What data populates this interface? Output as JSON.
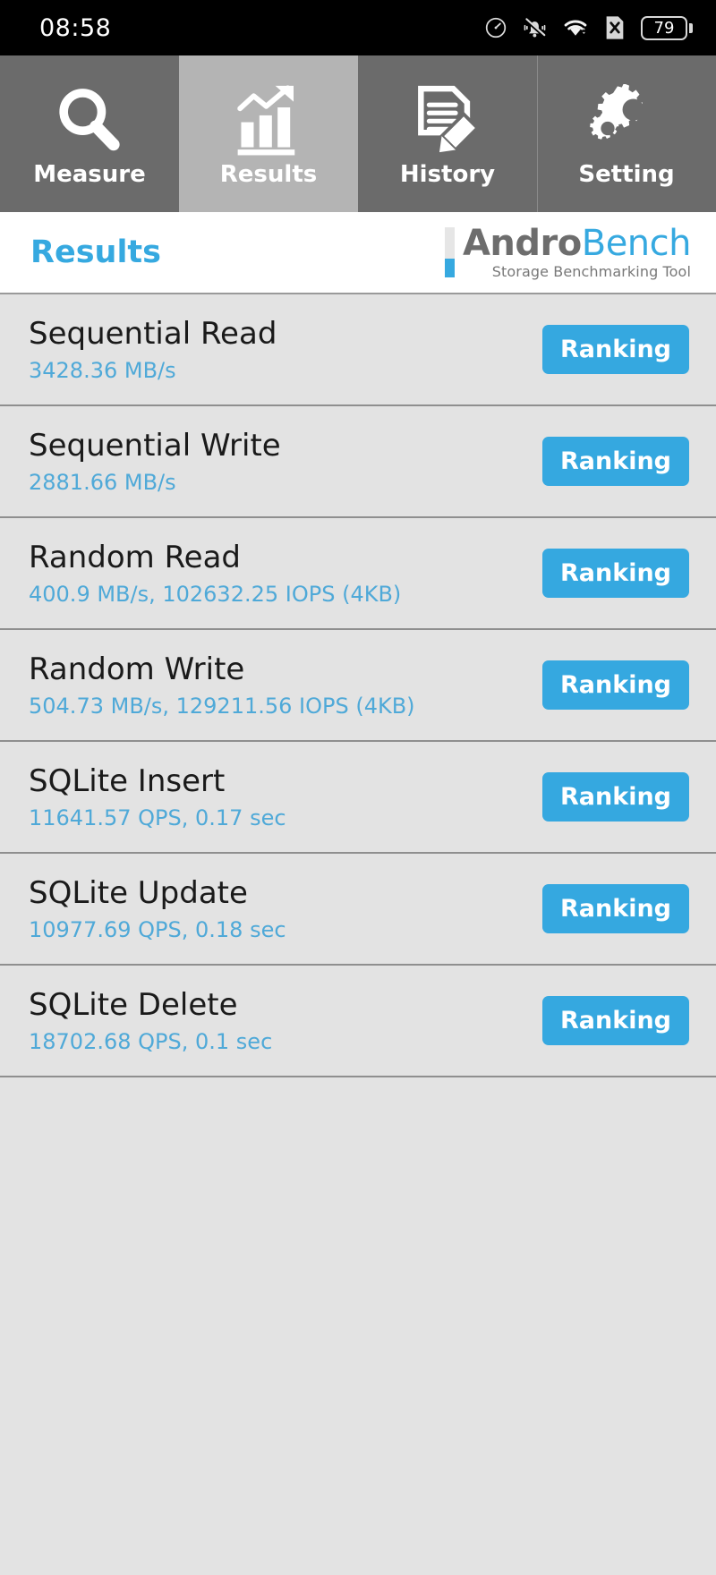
{
  "statusbar": {
    "time": "08:58",
    "battery_level": "79",
    "icons": [
      "speedometer-icon",
      "bell-muted-icon",
      "wifi-icon",
      "sim-x-icon",
      "battery-icon"
    ]
  },
  "tabs": [
    {
      "label": "Measure",
      "icon": "magnifier-icon",
      "active": false
    },
    {
      "label": "Results",
      "icon": "bar-chart-arrow-icon",
      "active": true
    },
    {
      "label": "History",
      "icon": "document-pencil-icon",
      "active": false
    },
    {
      "label": "Setting",
      "icon": "gears-icon",
      "active": false
    }
  ],
  "header": {
    "title": "Results",
    "logo_primary": "Andro",
    "logo_secondary": "Bench",
    "logo_tagline": "Storage Benchmarking Tool"
  },
  "colors": {
    "accent": "#36a9e0",
    "value_text": "#4fa9d8",
    "tab_inactive": "#6b6b6b",
    "tab_active": "#b4b4b4",
    "list_background": "#e3e3e3"
  },
  "results": [
    {
      "title": "Sequential Read",
      "value": "3428.36 MB/s",
      "button": "Ranking"
    },
    {
      "title": "Sequential Write",
      "value": "2881.66 MB/s",
      "button": "Ranking"
    },
    {
      "title": "Random Read",
      "value": "400.9 MB/s, 102632.25 IOPS (4KB)",
      "button": "Ranking"
    },
    {
      "title": "Random Write",
      "value": "504.73 MB/s, 129211.56 IOPS (4KB)",
      "button": "Ranking"
    },
    {
      "title": "SQLite Insert",
      "value": "11641.57 QPS, 0.17 sec",
      "button": "Ranking"
    },
    {
      "title": "SQLite Update",
      "value": "10977.69 QPS, 0.18 sec",
      "button": "Ranking"
    },
    {
      "title": "SQLite Delete",
      "value": "18702.68 QPS, 0.1 sec",
      "button": "Ranking"
    }
  ]
}
